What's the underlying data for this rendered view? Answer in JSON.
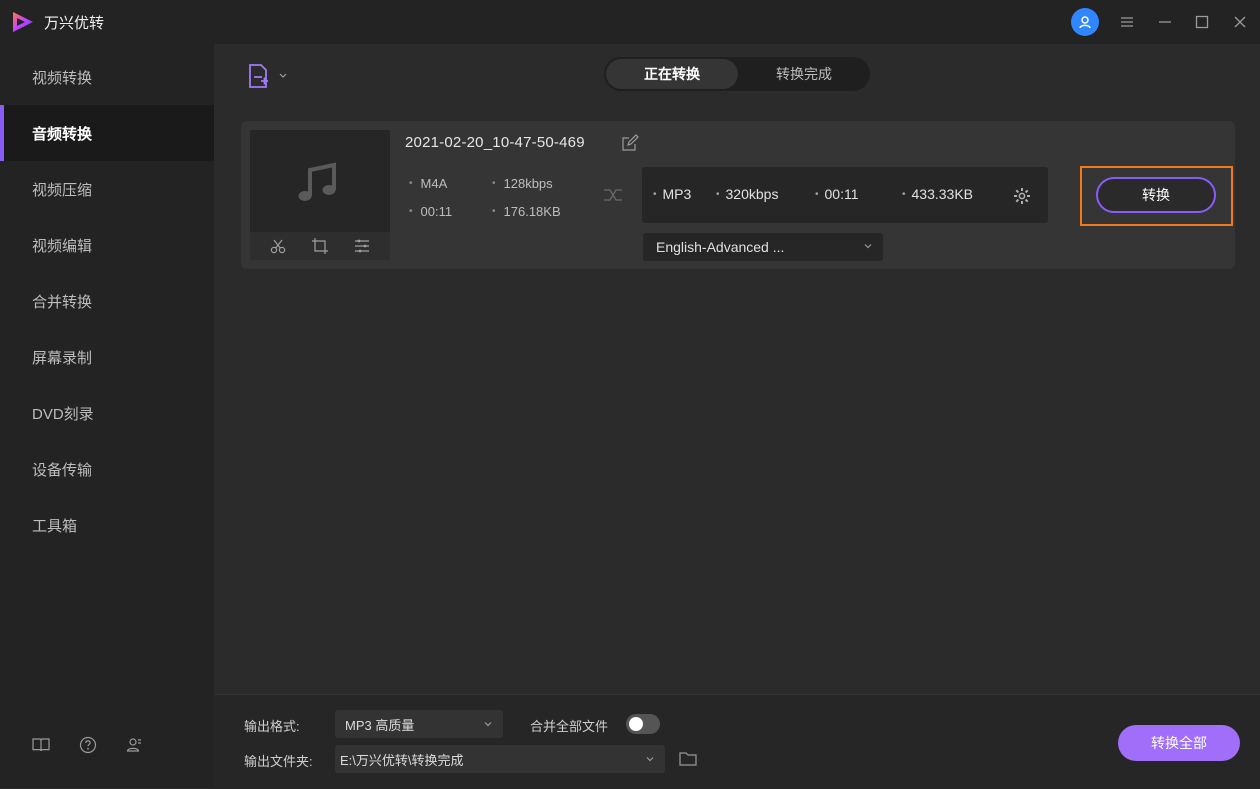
{
  "app": {
    "title": "万兴优转"
  },
  "sidebar": {
    "items": [
      {
        "label": "视频转换",
        "active": false
      },
      {
        "label": "音频转换",
        "active": true
      },
      {
        "label": "视频压缩",
        "active": false
      },
      {
        "label": "视频编辑",
        "active": false
      },
      {
        "label": "合并转换",
        "active": false
      },
      {
        "label": "屏幕录制",
        "active": false
      },
      {
        "label": "DVD刻录",
        "active": false
      },
      {
        "label": "设备传输",
        "active": false
      },
      {
        "label": "工具箱",
        "active": false
      }
    ],
    "bottom_icons": [
      "book-icon",
      "help-icon",
      "account-icon"
    ]
  },
  "tabs": {
    "converting": "正在转换",
    "completed": "转换完成"
  },
  "file": {
    "name": "2021-02-20_10-47-50-469",
    "source": {
      "format": "M4A",
      "bitrate": "128kbps",
      "duration": "00:11",
      "size": "176.18KB"
    },
    "target": {
      "format": "MP3",
      "bitrate": "320kbps",
      "duration": "00:11",
      "size": "433.33KB"
    },
    "language": "English-Advanced ...",
    "convert_label": "转换"
  },
  "bottom": {
    "output_format_label": "输出格式:",
    "output_format_value": "MP3 高质量",
    "merge_label": "合并全部文件",
    "merge_enabled": false,
    "output_folder_label": "输出文件夹:",
    "output_folder_value": "E:\\万兴优转\\转换完成",
    "convert_all_label": "转换全部"
  },
  "colors": {
    "accent": "#8a5cf6",
    "highlight": "#f07a1a",
    "avatar": "#2f86ff"
  }
}
